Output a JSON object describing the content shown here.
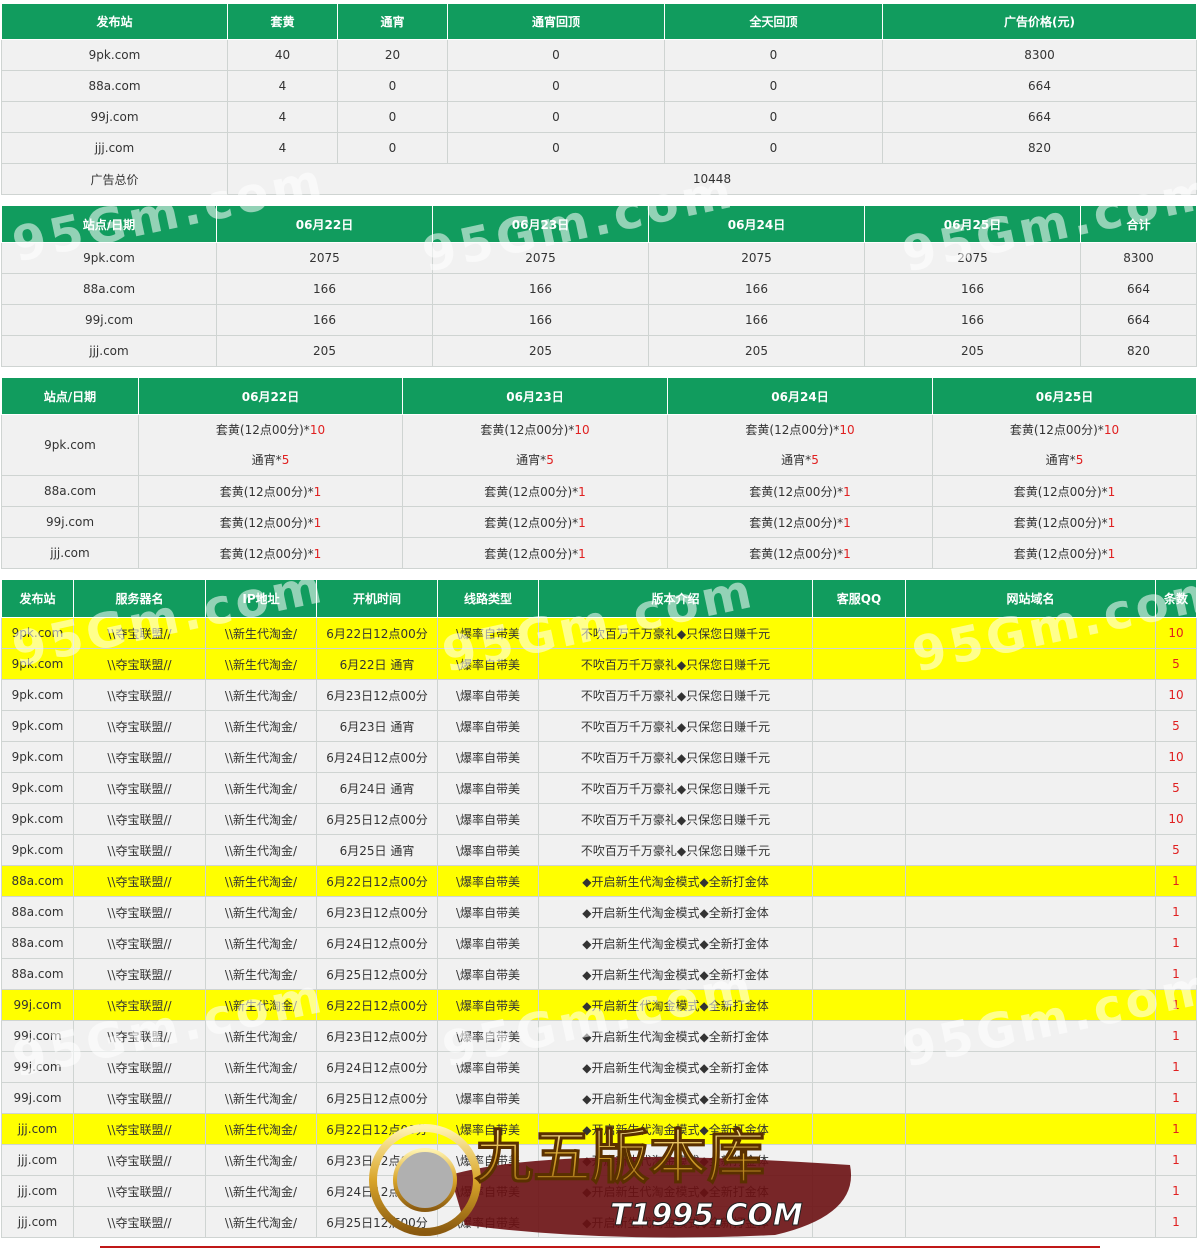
{
  "table1": {
    "headers": [
      "发布站",
      "套黄",
      "通宵",
      "通宵回顶",
      "全天回顶",
      "广告价格(元)"
    ],
    "rows": [
      [
        "9pk.com",
        "40",
        "20",
        "0",
        "0",
        "8300"
      ],
      [
        "88a.com",
        "4",
        "0",
        "0",
        "0",
        "664"
      ],
      [
        "99j.com",
        "4",
        "0",
        "0",
        "0",
        "664"
      ],
      [
        "jjj.com",
        "4",
        "0",
        "0",
        "0",
        "820"
      ]
    ],
    "total_label": "广告总价",
    "total_value": "10448"
  },
  "table2": {
    "headers": [
      "站点/日期",
      "06月22日",
      "06月23日",
      "06月24日",
      "06月25日",
      "合计"
    ],
    "rows": [
      [
        "9pk.com",
        "2075",
        "2075",
        "2075",
        "2075",
        "8300"
      ],
      [
        "88a.com",
        "166",
        "166",
        "166",
        "166",
        "664"
      ],
      [
        "99j.com",
        "166",
        "166",
        "166",
        "166",
        "664"
      ],
      [
        "jjj.com",
        "205",
        "205",
        "205",
        "205",
        "820"
      ]
    ]
  },
  "table3": {
    "headers": [
      "站点/日期",
      "06月22日",
      "06月23日",
      "06月24日",
      "06月25日"
    ],
    "first": {
      "site": "9pk.com",
      "line1": "套黄(12点00分)*",
      "qty1": "10",
      "line2": "通宵*",
      "qty2": "5"
    },
    "rows": [
      {
        "site": "88a.com",
        "text": "套黄(12点00分)*",
        "qty": "1"
      },
      {
        "site": "99j.com",
        "text": "套黄(12点00分)*",
        "qty": "1"
      },
      {
        "site": "jjj.com",
        "text": "套黄(12点00分)*",
        "qty": "1"
      }
    ]
  },
  "table4": {
    "headers": [
      "发布站",
      "服务器名",
      "IP地址",
      "开机时间",
      "线路类型",
      "版本介绍",
      "客服QQ",
      "网站域名",
      "条数"
    ],
    "server": "\\\\夺宝联盟//",
    "ip": "\\\\新生代淘金/",
    "line": "\\爆率自带美",
    "rows": [
      {
        "site": "9pk.com",
        "time": "6月22日12点00分",
        "intro": "不吹百万千万豪礼◆只保您日赚千元",
        "count": "10",
        "hl": true
      },
      {
        "site": "9pk.com",
        "time": "6月22日 通宵",
        "intro": "不吹百万千万豪礼◆只保您日赚千元",
        "count": "5",
        "hl": true
      },
      {
        "site": "9pk.com",
        "time": "6月23日12点00分",
        "intro": "不吹百万千万豪礼◆只保您日赚千元",
        "count": "10",
        "hl": false
      },
      {
        "site": "9pk.com",
        "time": "6月23日 通宵",
        "intro": "不吹百万千万豪礼◆只保您日赚千元",
        "count": "5",
        "hl": false
      },
      {
        "site": "9pk.com",
        "time": "6月24日12点00分",
        "intro": "不吹百万千万豪礼◆只保您日赚千元",
        "count": "10",
        "hl": false
      },
      {
        "site": "9pk.com",
        "time": "6月24日 通宵",
        "intro": "不吹百万千万豪礼◆只保您日赚千元",
        "count": "5",
        "hl": false
      },
      {
        "site": "9pk.com",
        "time": "6月25日12点00分",
        "intro": "不吹百万千万豪礼◆只保您日赚千元",
        "count": "10",
        "hl": false
      },
      {
        "site": "9pk.com",
        "time": "6月25日 通宵",
        "intro": "不吹百万千万豪礼◆只保您日赚千元",
        "count": "5",
        "hl": false
      },
      {
        "site": "88a.com",
        "time": "6月22日12点00分",
        "intro": "◆开启新生代淘金模式◆全新打金体",
        "count": "1",
        "hl": true
      },
      {
        "site": "88a.com",
        "time": "6月23日12点00分",
        "intro": "◆开启新生代淘金模式◆全新打金体",
        "count": "1",
        "hl": false
      },
      {
        "site": "88a.com",
        "time": "6月24日12点00分",
        "intro": "◆开启新生代淘金模式◆全新打金体",
        "count": "1",
        "hl": false
      },
      {
        "site": "88a.com",
        "time": "6月25日12点00分",
        "intro": "◆开启新生代淘金模式◆全新打金体",
        "count": "1",
        "hl": false
      },
      {
        "site": "99j.com",
        "time": "6月22日12点00分",
        "intro": "◆开启新生代淘金模式◆全新打金体",
        "count": "1",
        "hl": true
      },
      {
        "site": "99j.com",
        "time": "6月23日12点00分",
        "intro": "◆开启新生代淘金模式◆全新打金体",
        "count": "1",
        "hl": false
      },
      {
        "site": "99j.com",
        "time": "6月24日12点00分",
        "intro": "◆开启新生代淘金模式◆全新打金体",
        "count": "1",
        "hl": false
      },
      {
        "site": "99j.com",
        "time": "6月25日12点00分",
        "intro": "◆开启新生代淘金模式◆全新打金体",
        "count": "1",
        "hl": false
      },
      {
        "site": "jjj.com",
        "time": "6月22日12点00分",
        "intro": "◆开启新生代淘金模式◆全新打金体",
        "count": "1",
        "hl": true
      },
      {
        "site": "jjj.com",
        "time": "6月23日12点00分",
        "intro": "◆开启新生代淘金模式◆全新打金体",
        "count": "1",
        "hl": false
      },
      {
        "site": "jjj.com",
        "time": "6月24日12点00分",
        "intro": "◆开启新生代淘金模式◆全新打金体",
        "count": "1",
        "hl": false
      },
      {
        "site": "jjj.com",
        "time": "6月25日12点00分",
        "intro": "◆开启新生代淘金模式◆全新打金体",
        "count": "1",
        "hl": false
      }
    ]
  },
  "watermark": "95Gm.com",
  "logo": {
    "title": "九五版本库",
    "domain": "T1995.COM"
  },
  "colors": {
    "header": "#119c5e",
    "highlight": "#ffff00",
    "count": "#e02020"
  }
}
